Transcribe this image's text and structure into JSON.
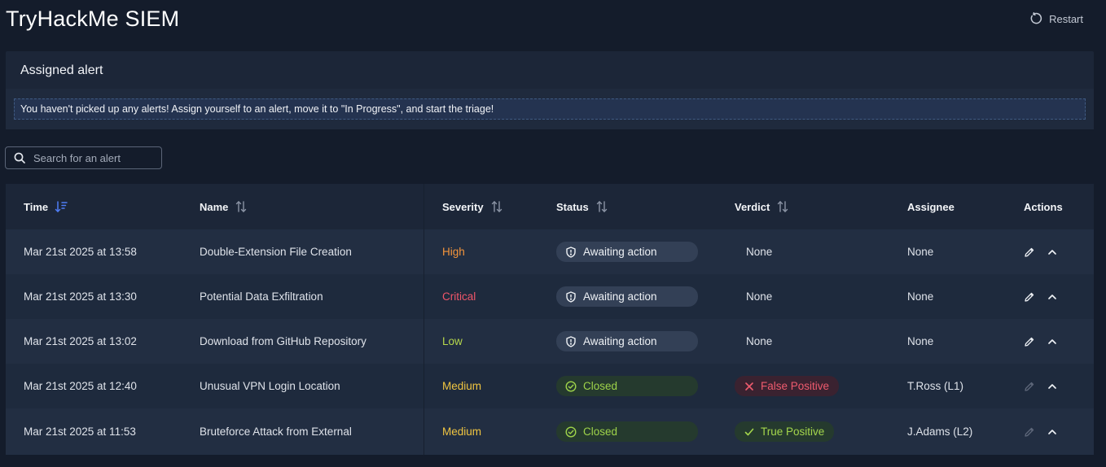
{
  "app": {
    "title": "TryHackMe SIEM",
    "restart_label": "Restart"
  },
  "assigned": {
    "title": "Assigned alert",
    "notice": "You haven't picked up any alerts! Assign yourself to an alert, move it to \"In Progress\", and start the triage!"
  },
  "search": {
    "placeholder": "Search for an alert",
    "icon": "search-icon"
  },
  "table": {
    "columns": {
      "time": "Time",
      "name": "Name",
      "severity": "Severity",
      "status": "Status",
      "verdict": "Verdict",
      "assignee": "Assignee",
      "actions": "Actions"
    },
    "rows": [
      {
        "time": "Mar 21st 2025 at 13:58",
        "name": "Double-Extension File Creation",
        "severity": "High",
        "status": "Awaiting action",
        "verdict": "None",
        "assignee": "None"
      },
      {
        "time": "Mar 21st 2025 at 13:30",
        "name": "Potential Data Exfiltration",
        "severity": "Critical",
        "status": "Awaiting action",
        "verdict": "None",
        "assignee": "None"
      },
      {
        "time": "Mar 21st 2025 at 13:02",
        "name": "Download from GitHub Repository",
        "severity": "Low",
        "status": "Awaiting action",
        "verdict": "None",
        "assignee": "None"
      },
      {
        "time": "Mar 21st 2025 at 12:40",
        "name": "Unusual VPN Login Location",
        "severity": "Medium",
        "status": "Closed",
        "verdict": "False Positive",
        "assignee": "T.Ross (L1)"
      },
      {
        "time": "Mar 21st 2025 at 11:53",
        "name": "Bruteforce Attack from External",
        "severity": "Medium",
        "status": "Closed",
        "verdict": "True Positive",
        "assignee": "J.Adams (L2)"
      }
    ]
  },
  "colors": {
    "background": "#141c2b",
    "severity_high": "#f5953b",
    "severity_critical": "#f0566a",
    "severity_low": "#b6d84c",
    "severity_medium": "#f0c541",
    "closed_green": "#9ed34a",
    "false_positive_red": "#ef5b6e",
    "sort_active_blue": "#4f7df5"
  }
}
